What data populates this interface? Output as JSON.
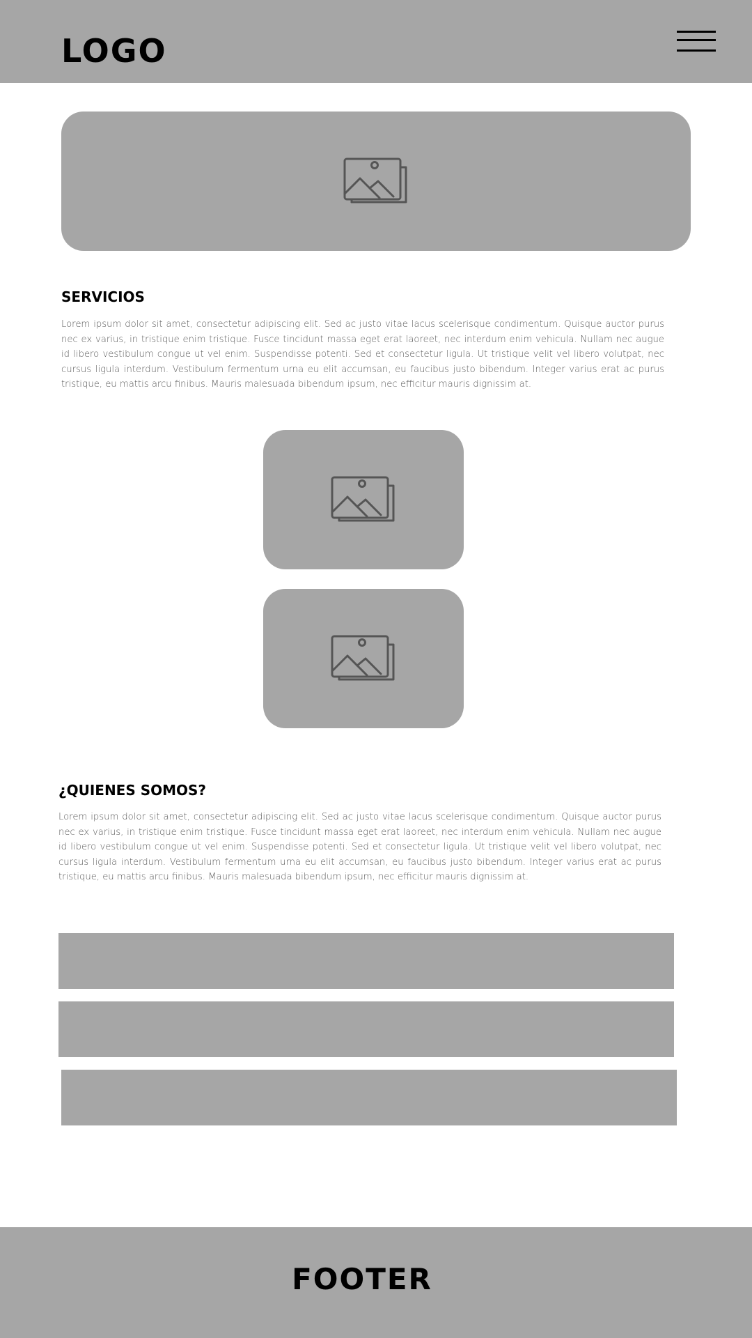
{
  "header": {
    "logo": "LOGO",
    "menu_icon": "hamburger-menu-icon"
  },
  "hero": {
    "icon": "image-gallery-icon"
  },
  "servicios": {
    "title": "SERVICIOS",
    "text": "Lorem ipsum dolor sit amet, consectetur adipiscing elit. Sed ac justo vitae lacus scelerisque condimentum. Quisque auctor purus nec ex varius, in tristique enim tristique. Fusce tincidunt massa eget erat laoreet, nec interdum enim vehicula. Nullam nec augue id libero vestibulum congue ut vel enim. Suspendisse potenti. Sed et consectetur ligula. Ut tristique velit vel libero volutpat, nec cursus ligula interdum. Vestibulum fermentum urna eu elit accumsan, eu faucibus justo bibendum. Integer varius erat ac purus tristique, eu mattis arcu finibus. Mauris malesuada bibendum ipsum, nec efficitur mauris dignissim at."
  },
  "cards": [
    {
      "icon": "image-gallery-icon"
    },
    {
      "icon": "image-gallery-icon"
    }
  ],
  "quienes": {
    "title": "¿QUIENES SOMOS?",
    "text": "Lorem ipsum dolor sit amet, consectetur adipiscing elit. Sed ac justo vitae lacus scelerisque condimentum. Quisque auctor purus nec ex varius, in tristique enim tristique. Fusce tincidunt massa eget erat laoreet, nec interdum enim vehicula. Nullam nec augue id libero vestibulum congue ut vel enim. Suspendisse potenti. Sed et consectetur ligula. Ut tristique velit vel libero volutpat, nec cursus ligula interdum. Vestibulum fermentum urna eu elit accumsan, eu faucibus justo bibendum. Integer varius erat ac purus tristique, eu mattis arcu finibus. Mauris malesuada bibendum ipsum, nec efficitur mauris dignissim at."
  },
  "footer": {
    "label": "FOOTER"
  },
  "colors": {
    "placeholder": "#a6a6a6",
    "icon_stroke": "#555555",
    "text": "#5a5a5a"
  }
}
